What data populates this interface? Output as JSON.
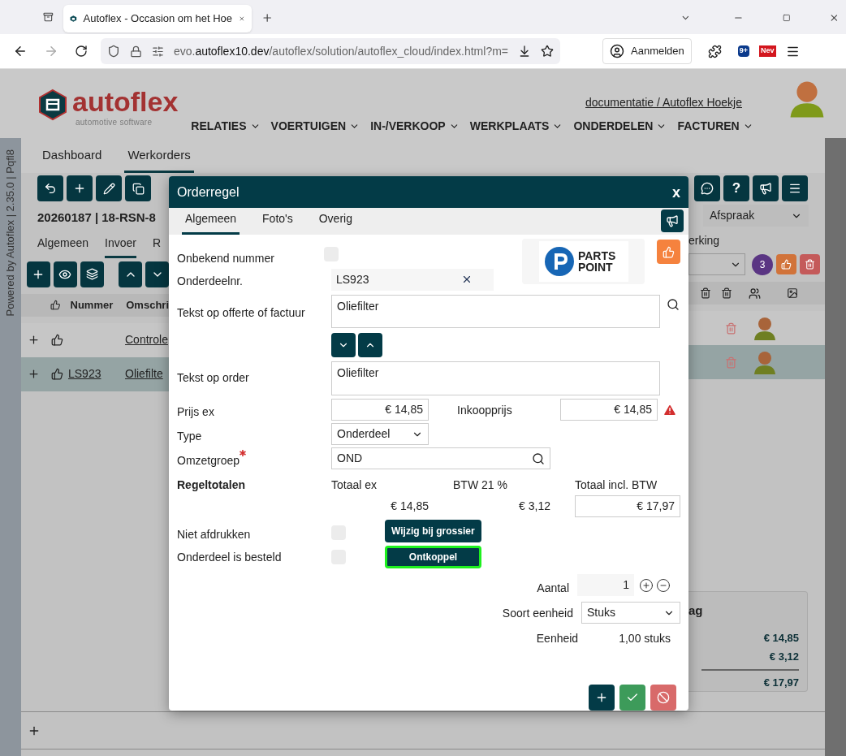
{
  "browser": {
    "tab_title": "Autoflex - Occasion om het Hoe",
    "url_prefix": "evo.",
    "url_host": "autoflex10.dev",
    "url_path": "/autoflex/solution/autoflex_cloud/index.html?m=",
    "signin": "Aanmelden",
    "badges": [
      "9+",
      "Nev"
    ]
  },
  "app": {
    "logo": {
      "name": "autoflex",
      "tagline": "automotive software"
    },
    "nav": [
      "RELATIES",
      "VOERTUIGEN",
      "IN-/VERKOOP",
      "WERKPLAATS",
      "ONDERDELEN",
      "FACTUREN"
    ],
    "user_link": "documentatie / Autoflex Hoekje",
    "side_text": "Powered by Autoflex | 2.35.0 | Pqfl8",
    "main_tabs": [
      {
        "label": "Dashboard",
        "selected": false
      },
      {
        "label": "Werkorders",
        "selected": true
      }
    ],
    "order_title": "20260187 | 18-RSN-8",
    "help": "?",
    "sub_tabs": [
      {
        "label": "Algemeen",
        "selected": false
      },
      {
        "label": "Invoer",
        "selected": true
      },
      {
        "label": "R",
        "selected": false
      }
    ],
    "sub_tab_right": "erking",
    "status_select": "Afspraak",
    "count_badge": "3",
    "table": {
      "columns": [
        "Nummer",
        "Omschri"
      ],
      "rows": [
        {
          "nummer": "",
          "omschrijving": "Controle",
          "selected": false
        },
        {
          "nummer": "LS923",
          "omschrijving": "Oliefilte",
          "selected": true
        }
      ]
    },
    "summary": {
      "title": "ag",
      "amounts": [
        "€ 14,85",
        "€ 3,12",
        "€ 17,97"
      ]
    }
  },
  "dialog": {
    "title": "Orderregel",
    "close": "x",
    "tabs": [
      {
        "label": "Algemeen",
        "selected": true
      },
      {
        "label": "Foto's",
        "selected": false
      },
      {
        "label": "Overig",
        "selected": false
      }
    ],
    "supplier_logo": [
      "PARTS",
      "POINT"
    ],
    "onbekend_nummer": {
      "label": "Onbekend nummer",
      "checked": false
    },
    "onderdeelnr": {
      "label": "Onderdeelnr.",
      "value": "LS923"
    },
    "tekst_offerte": {
      "label": "Tekst op offerte of factuur",
      "value": "Oliefilter"
    },
    "tekst_order": {
      "label": "Tekst op order",
      "value": "Oliefilter"
    },
    "prijs_ex": {
      "label": "Prijs ex",
      "value": "€ 14,85"
    },
    "inkoopprijs": {
      "label": "Inkoopprijs",
      "value": "€ 14,85"
    },
    "type": {
      "label": "Type",
      "value": "Onderdeel"
    },
    "omzetgroep": {
      "label": "Omzetgroep",
      "value": "OND",
      "required": true
    },
    "regeltotalen": {
      "label": "Regeltotalen",
      "totaal_ex_label": "Totaal ex",
      "btw_label": "BTW 21 %",
      "totaal_incl_label": "Totaal incl. BTW",
      "totaal_ex": "€ 14,85",
      "btw": "€ 3,12",
      "totaal_incl": "€ 17,97"
    },
    "niet_afdrukken": {
      "label": "Niet afdrukken",
      "checked": false
    },
    "besteld": {
      "label": "Onderdeel is besteld",
      "checked": false
    },
    "wijzig_button": "Wijzig bij grossier",
    "ontkoppel_button": {
      "label": "Ontkoppel",
      "focused": true
    },
    "aantal": {
      "label": "Aantal",
      "value": "1"
    },
    "soort_eenheid": {
      "label": "Soort eenheid",
      "value": "Stuks"
    },
    "eenheid": {
      "label": "Eenheid",
      "value": "1,00 stuks"
    }
  }
}
